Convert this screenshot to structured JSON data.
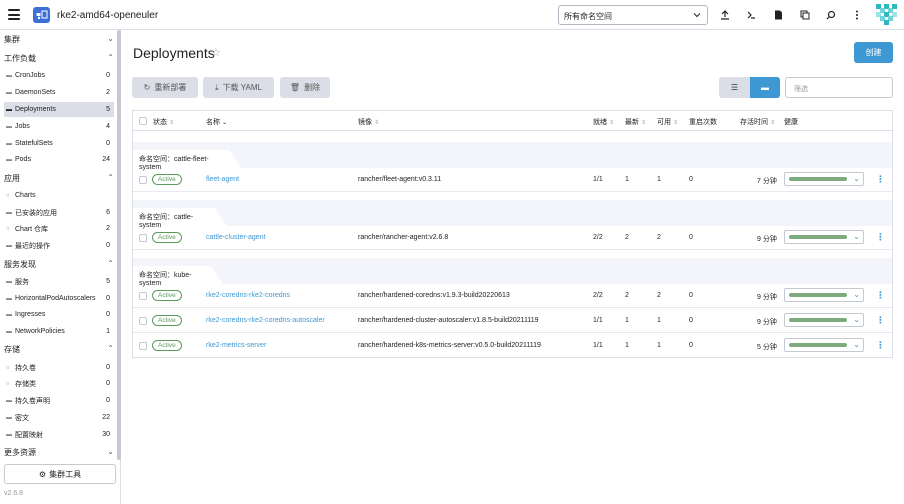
{
  "header": {
    "cluster_name": "rke2-amd64-openeuler",
    "namespace_select": "所有命名空间",
    "icons": [
      "upload-icon",
      "kubectl-shell-icon",
      "file-icon",
      "copy-icon",
      "search-icon",
      "more-vert-icon"
    ]
  },
  "sidebar": {
    "groups": {
      "cluster": "集群",
      "workloads": "工作负载",
      "apps": "应用",
      "service_discovery": "服务发现",
      "storage": "存储",
      "more": "更多资源"
    },
    "workloads": [
      {
        "label": "CronJobs",
        "count": "0"
      },
      {
        "label": "DaemonSets",
        "count": "2"
      },
      {
        "label": "Deployments",
        "count": "5"
      },
      {
        "label": "Jobs",
        "count": "4"
      },
      {
        "label": "StatefulSets",
        "count": "0"
      },
      {
        "label": "Pods",
        "count": "24"
      }
    ],
    "apps": [
      {
        "label": "Charts",
        "count": ""
      },
      {
        "label": "已安装的应用",
        "count": "6"
      },
      {
        "label": "Chart 仓库",
        "count": "2"
      },
      {
        "label": "最近的操作",
        "count": "0"
      }
    ],
    "service_discovery": [
      {
        "label": "服务",
        "count": "5"
      },
      {
        "label": "HorizontalPodAutoscalers",
        "count": "0"
      },
      {
        "label": "Ingresses",
        "count": "0"
      },
      {
        "label": "NetworkPolicies",
        "count": "1"
      }
    ],
    "storage": [
      {
        "label": "持久卷",
        "count": "0"
      },
      {
        "label": "存储类",
        "count": "0"
      },
      {
        "label": "持久卷声明",
        "count": "0"
      },
      {
        "label": "密文",
        "count": "22"
      },
      {
        "label": "配置映射",
        "count": "30"
      }
    ],
    "cluster_tools": "集群工具",
    "version": "v2.6.8"
  },
  "main": {
    "title": "Deployments",
    "create_label": "创建",
    "actions": {
      "redeploy": "重新部署",
      "download_yaml": "下载 YAML",
      "delete": "删除"
    },
    "filter_placeholder": "筛选",
    "columns": {
      "state": "状态",
      "name": "名称",
      "image": "镜像",
      "ready": "就绪",
      "up_to_date": "最新",
      "available": "可用",
      "restarts": "重启次数",
      "age": "存活时间",
      "health": "健康"
    },
    "namespace_prefix": "命名空间：",
    "groups": [
      {
        "namespace": "cattle-fleet-system",
        "rows": [
          {
            "state": "Active",
            "name": "fleet-agent",
            "image": "rancher/fleet-agent:v0.3.11",
            "ready": "1/1",
            "up_to_date": "1",
            "available": "1",
            "restarts": "0",
            "age": "7 分钟"
          }
        ]
      },
      {
        "namespace": "cattle-system",
        "rows": [
          {
            "state": "Active",
            "name": "cattle-cluster-agent",
            "image": "rancher/rancher-agent:v2.6.8",
            "ready": "2/2",
            "up_to_date": "2",
            "available": "2",
            "restarts": "0",
            "age": "9 分钟"
          }
        ]
      },
      {
        "namespace": "kube-system",
        "rows": [
          {
            "state": "Active",
            "name": "rke2-coredns-rke2-coredns",
            "image": "rancher/hardened-coredns:v1.9.3-build20220613",
            "ready": "2/2",
            "up_to_date": "2",
            "available": "2",
            "restarts": "0",
            "age": "9 分钟"
          },
          {
            "state": "Active",
            "name": "rke2-coredns-rke2-coredns-autoscaler",
            "image": "rancher/hardened-cluster-autoscaler:v1.8.5-build20211119",
            "ready": "1/1",
            "up_to_date": "1",
            "available": "1",
            "restarts": "0",
            "age": "9 分钟"
          },
          {
            "state": "Active",
            "name": "rke2-metrics-server",
            "image": "rancher/hardened-k8s-metrics-server:v0.5.0-build20211119",
            "ready": "1/1",
            "up_to_date": "1",
            "available": "1",
            "restarts": "0",
            "age": "5 分钟"
          }
        ]
      }
    ]
  },
  "colors": {
    "accent": "#3d98d3",
    "active_green": "#5d995d",
    "health_bar": "#7dab7d",
    "cluster_badge": "#3d6fd8"
  }
}
